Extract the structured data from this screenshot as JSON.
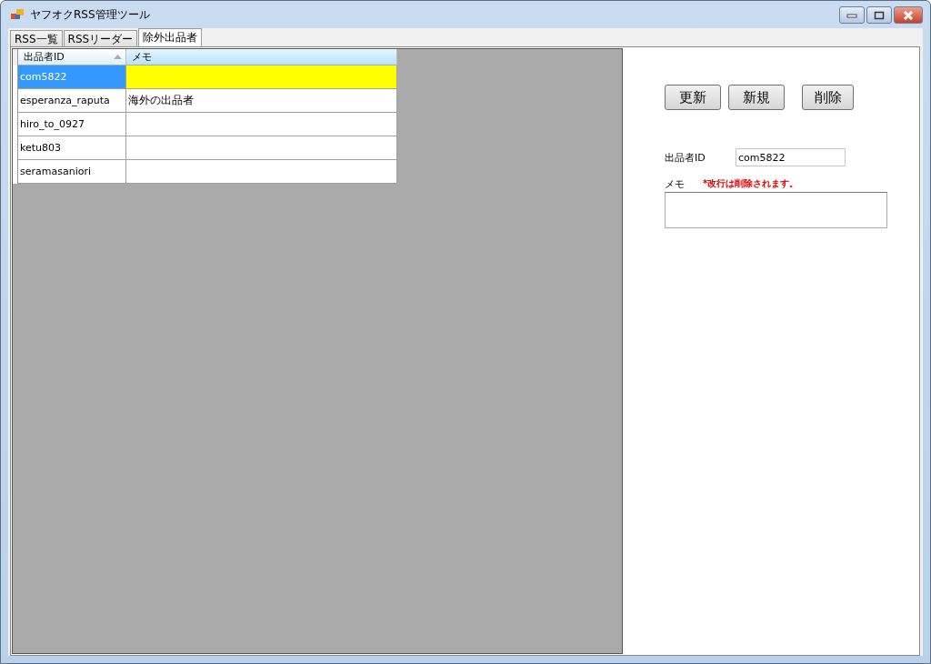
{
  "window": {
    "title": "ヤフオクRSS管理ツール"
  },
  "tabs": [
    {
      "label": "RSS一覧",
      "selected": false
    },
    {
      "label": "RSSリーダー",
      "selected": false
    },
    {
      "label": "除外出品者",
      "selected": true
    }
  ],
  "grid": {
    "columns": [
      {
        "label": "出品者ID",
        "sorted": true
      },
      {
        "label": "メモ",
        "sorted": false
      }
    ],
    "rows": [
      {
        "seller_id": "com5822",
        "memo": "",
        "selected": true
      },
      {
        "seller_id": "esperanza_raputa",
        "memo": "海外の出品者",
        "selected": false
      },
      {
        "seller_id": "hiro_to_0927",
        "memo": "",
        "selected": false
      },
      {
        "seller_id": "ketu803",
        "memo": "",
        "selected": false
      },
      {
        "seller_id": "seramasaniori",
        "memo": "",
        "selected": false
      }
    ]
  },
  "buttons": [
    "更新",
    "新規",
    "削除"
  ],
  "form": {
    "id_label": "出品者ID",
    "id_value": "com5822",
    "memo_label": "メモ",
    "memo_note": "*改行は削除されます。"
  }
}
